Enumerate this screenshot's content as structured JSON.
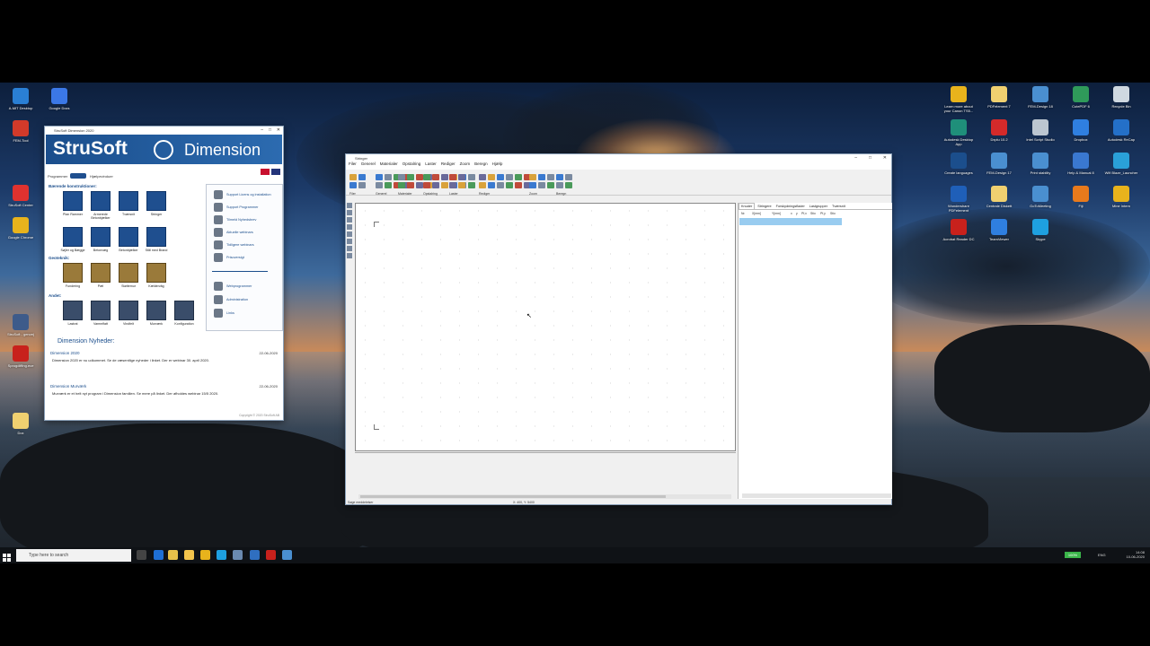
{
  "desktop": {
    "left_icons": [
      {
        "label": "A-MIT Desktop",
        "color": "#2a7fd4"
      },
      {
        "label": "Google Docs",
        "color": "#3b78e7"
      },
      {
        "label": "FEM-Tool",
        "color": "#d23a2a"
      },
      {
        "label": "StruSoft Center",
        "color": "#e0322f"
      },
      {
        "label": "Google Chrome",
        "color": "#e8b31c"
      },
      {
        "label": "StruSoft - genvej",
        "color": "#3d5b8a"
      },
      {
        "label": "Sprogdiffing.ece",
        "color": "#c8211c"
      },
      {
        "label": "Dox",
        "color": "#f0d070"
      }
    ],
    "right_icons": [
      {
        "label": "Learn more about your Canon TS5...",
        "color": "#e8b31c"
      },
      {
        "label": "PDFelement 7",
        "color": "#f0d070"
      },
      {
        "label": "FEM-Design 18",
        "color": "#4a8fd0"
      },
      {
        "label": "CutePDF 6",
        "color": "#2f9a5a"
      },
      {
        "label": "Recycle Bin",
        "color": "#cfd8e0"
      },
      {
        "label": "Autodesk Desktop App",
        "color": "#1f8f7a"
      },
      {
        "label": "Dxplu 10.2",
        "color": "#d42a2a"
      },
      {
        "label": "Intel Script Studio",
        "color": "#bcc6d0"
      },
      {
        "label": "Dropbox",
        "color": "#2f7fe0"
      },
      {
        "label": "Autodesk ReCap",
        "color": "#2470c8"
      },
      {
        "label": "Create languages",
        "color": "#1b4e8c"
      },
      {
        "label": "FEM-Design 17",
        "color": "#4a8fd0"
      },
      {
        "label": "Print stability",
        "color": "#4a8fd0"
      },
      {
        "label": "Help & Manual 8",
        "color": "#3a78d0"
      },
      {
        "label": "Wifi Blaze_Launcher",
        "color": "#2aa0d8"
      },
      {
        "label": "Wondershare PDFelement",
        "color": "#1f5fb8"
      },
      {
        "label": "Centrale Diskett",
        "color": "#f0d070"
      },
      {
        "label": "GoToMeeting",
        "color": "#4a8fd0"
      },
      {
        "label": "Fiji",
        "color": "#e87a1c"
      },
      {
        "label": "Mine Intern",
        "color": "#e8b31c"
      },
      {
        "label": "Acrobat Reader DC",
        "color": "#c8211c"
      },
      {
        "label": "TeamViewer",
        "color": "#2f7fe0"
      },
      {
        "label": "Skype",
        "color": "#1ea0e0"
      }
    ]
  },
  "taskbar": {
    "search_placeholder": "Type here to search",
    "battery": "100%",
    "language": "ENG",
    "time": "14:08",
    "date": "10-06-2020"
  },
  "strusoft": {
    "title": "StruSoft Dimension 2020",
    "brand": "StruSoft",
    "product": "Dimension",
    "nav_left": "Programmer",
    "nav_right": "Hjælpevinduer",
    "sections": [
      {
        "title": "Bærende konstruktioner:",
        "items": [
          "Plan Rammer",
          "Armerede Betonbjælker",
          "Tværsnit",
          "Stringer",
          "Søjler og Bægge",
          "Betonvæg",
          "Betonbjælker",
          "Stål med Brand"
        ]
      },
      {
        "title": "Geoteknik:",
        "items": [
          "Fundering",
          "Pæl",
          "Støttemur",
          "Kælderväg"
        ]
      },
      {
        "title": "Andet:",
        "items": [
          "Lastrat",
          "Varmelfatt",
          "Vindfelt",
          "Murværk",
          "Konfiguration"
        ]
      }
    ],
    "side_links": [
      "Support Licens og installation",
      "Support Programmer",
      "Tilmeld Nyhedsbrev",
      "Aktuelle webinars",
      "Tidligere webinars",
      "Prisoversigt",
      "Webprogrammer",
      "Administration",
      "Links"
    ],
    "news_title": "Dimension Nyheder:",
    "news": [
      {
        "heading": "Dimension 2020",
        "date": "22-06-2020",
        "text": "Dimension 2020 er nu udkommet. Se de væsentlige nyheder i linket. Der er webinar 30. april 2020."
      },
      {
        "heading": "Dimension Murværk",
        "date": "22-06-2020",
        "text": "Murværk er et helt nyt program i Dimension familien. Se mere på linket. Der afholdes webinar 15/5 2020."
      }
    ],
    "footer": "Copyright © 2020 StruSoft AB"
  },
  "stringer": {
    "title": "Stringer",
    "menu": [
      "Filer",
      "Generel",
      "Materialer",
      "Opstalring",
      "Laster",
      "Rediger",
      "Zoom",
      "Beregn",
      "Hjælp"
    ],
    "toolbar_groups": [
      "Filer",
      "Generel",
      "Materialer",
      "Opstalring",
      "Laster",
      "Rediger",
      "Zoom",
      "Beregn"
    ],
    "tabs": [
      "Knuder",
      "Stringere",
      "Forskydningsflader",
      "Lastgrupper",
      "Tværsnit"
    ],
    "grid_columns": [
      "Nr.",
      "X[mm]",
      "Y[mm]",
      "x",
      "y",
      "Pf,x",
      "Stiv.",
      "Pf,y",
      "Stiv."
    ],
    "status_left": "Søge meddelelser",
    "status_coords": "X: 400, Y: 5400"
  }
}
